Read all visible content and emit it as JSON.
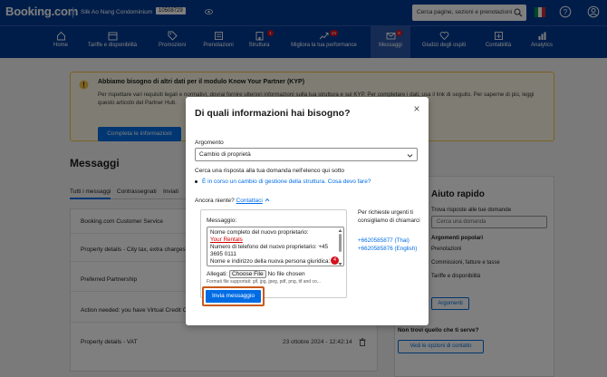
{
  "header": {
    "logo": "Booking.com",
    "property_name": "Silk Ao Nang Condominium",
    "property_id": "10508729",
    "search_placeholder": "Cerca pagine, sezioni e prenotazioni"
  },
  "nav": {
    "items": [
      {
        "label": "Home",
        "icon": "home-icon"
      },
      {
        "label": "Tariffe e disponibilità",
        "icon": "calendar-icon"
      },
      {
        "label": "Promozioni",
        "icon": "tag-icon"
      },
      {
        "label": "Prenotazioni",
        "icon": "bookings-icon"
      },
      {
        "label": "Struttura",
        "icon": "property-icon",
        "badge": "1"
      },
      {
        "label": "Migliora la tua performance",
        "icon": "growth-icon",
        "badge": "24"
      },
      {
        "label": "Messaggi",
        "icon": "mail-icon",
        "badge": "6"
      },
      {
        "label": "Giudizi degli ospiti",
        "icon": "heart-icon"
      },
      {
        "label": "Contabilità",
        "icon": "accounting-icon"
      },
      {
        "label": "Analytics",
        "icon": "chart-icon"
      }
    ]
  },
  "kyp": {
    "title": "Abbiamo bisogno di altri dati per il modulo Know Your Partner (KYP)",
    "text": "Per rispettare vari requisiti legali e normativi, dovrai fornire ulteriori informazioni sulla tua struttura e sul KYP. Per completare i dati, usa il link di seguito. Per saperne di più, leggi questo articolo del Partner Hub.",
    "button": "Completa le informazioni"
  },
  "messages": {
    "title": "Messaggi",
    "tabs": [
      "Tutti i messaggi",
      "Contrassegnati",
      "Inviati"
    ],
    "rows": [
      {
        "subject": "Booking.com Customer Service",
        "date": ""
      },
      {
        "subject": "Property details - City tax, extra charges",
        "date": ""
      },
      {
        "subject": "Preferred Partnership",
        "date": ""
      },
      {
        "subject": "Action needed: you have Virtual Credit Cards",
        "date": ""
      },
      {
        "subject": "Property details - VAT",
        "date": "23 ottobre 2024 - 12:42:14"
      }
    ]
  },
  "sidebar": {
    "title": "Aiuto rapido",
    "subtitle": "Trova risposte alle tue domande",
    "input_placeholder": "Cerca una domanda",
    "popular_title": "Argomenti popolari",
    "links": [
      "Prenotazioni",
      "Commissioni, fatture e tasse",
      "Tariffe e disponibilità"
    ],
    "topics_button": "Argomenti",
    "question": "Non trovi quello che ti serve?",
    "contact_button": "Vedi le opzioni di contatto"
  },
  "modal": {
    "title": "Di quali informazioni hai bisogno?",
    "close_label": "×",
    "topic_label": "Argomento",
    "topic_value": "Cambio di proprietà",
    "search_hint": "Cerca una risposta alla tua domanda nell'elenco qui sotto",
    "faq_link": "È in corso un cambio di gestione della struttura. Cosa devo fare?",
    "still_need": "Ancora niente?",
    "contact_link": "Contattaci",
    "message_label": "Messaggio:",
    "message_lines": [
      "Nome completo del nuovo proprietario:",
      "Your Rentals",
      "Numero di telefono del nuovo proprietario: +45",
      "3695 0111",
      "Nome e indirizzo della nuova persona giuridica:"
    ],
    "spell_count": "4",
    "attach_label": "Allegati:",
    "file_button": "Choose File",
    "file_status": "No file chosen",
    "formats": "Formati file supportati: gif, jpg, jpeg, pdf, png, tif and co...",
    "send_button": "Invia messaggio",
    "urgent_text": "Per richieste urgenti ti consigliamo di chiamarci",
    "phones": [
      "+6620585877 (Thai)",
      "+6620585876 (English)"
    ]
  },
  "colors": {
    "brand": "#003b95",
    "accent": "#006ce4",
    "badge": "#d4111e"
  }
}
